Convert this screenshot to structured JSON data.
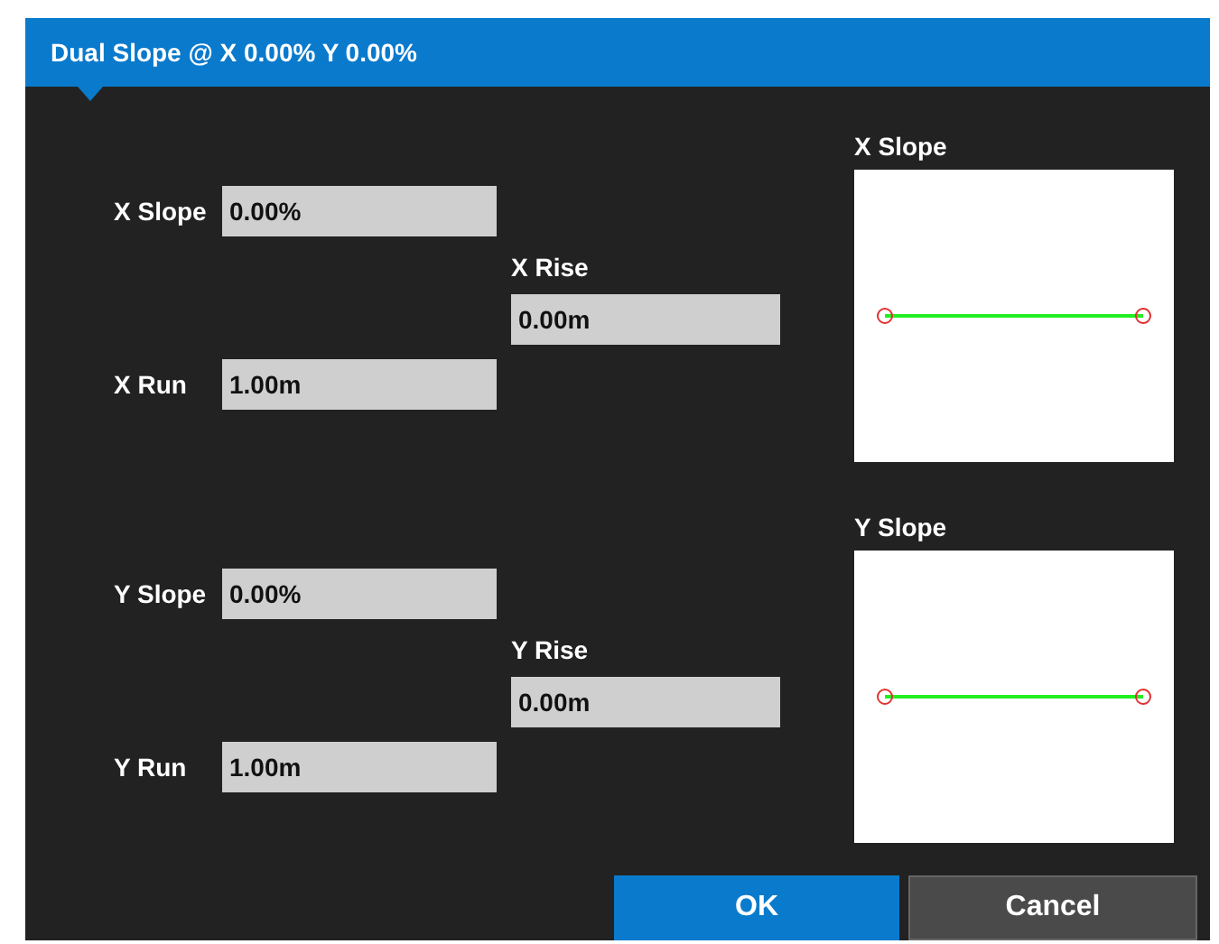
{
  "dialog": {
    "title": "Dual Slope @ X 0.00% Y 0.00%"
  },
  "sections": [
    {
      "slope": {
        "label": "X Slope",
        "value": "0.00%"
      },
      "rise": {
        "label": "X Rise",
        "value": "0.00m"
      },
      "run": {
        "label": "X Run",
        "value": "1.00m"
      },
      "preview": {
        "title": "X Slope"
      }
    },
    {
      "slope": {
        "label": "Y Slope",
        "value": "0.00%"
      },
      "rise": {
        "label": "Y Rise",
        "value": "0.00m"
      },
      "run": {
        "label": "Y Run",
        "value": "1.00m"
      },
      "preview": {
        "title": "Y Slope"
      }
    }
  ],
  "buttons": [
    {
      "label": "OK",
      "kind": "primary"
    },
    {
      "label": "Cancel",
      "kind": "secondary"
    }
  ]
}
